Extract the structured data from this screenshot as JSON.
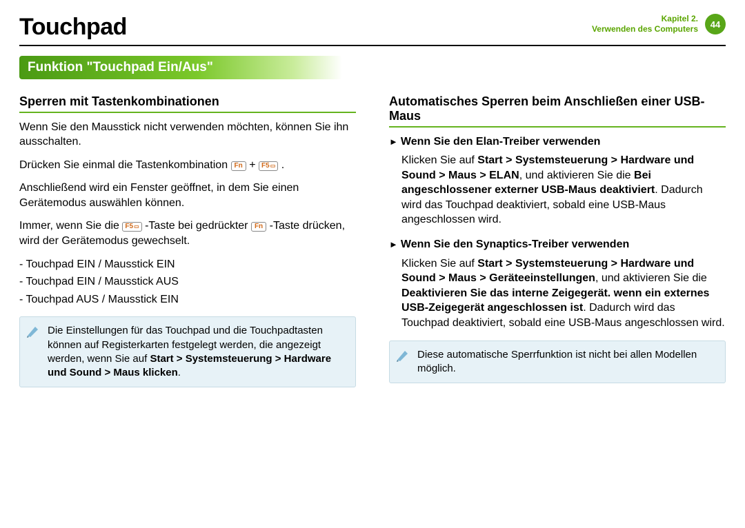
{
  "header": {
    "title": "Touchpad",
    "chapter_line1": "Kapitel 2.",
    "chapter_line2": "Verwenden des Computers",
    "page_number": "44"
  },
  "banner": {
    "label": "Funktion \"Touchpad Ein/Aus\""
  },
  "left": {
    "subhead": "Sperren mit Tastenkombinationen",
    "p1": "Wenn Sie den Mausstick nicht verwenden möchten, können Sie ihn ausschalten.",
    "p2_a": "Drücken Sie einmal die Tastenkombination ",
    "key_fn": "Fn",
    "plus": " + ",
    "key_f5_label": "F5",
    "p2_b": " .",
    "p3": "Anschließend wird ein Fenster geöffnet, in dem Sie einen Gerätemodus auswählen können.",
    "p4_a": "Immer, wenn Sie die ",
    "p4_b": " -Taste bei gedrückter ",
    "p4_c": " -Taste drücken, wird der Gerätemodus gewechselt.",
    "li1": "- Touchpad EIN / Mausstick EIN",
    "li2": "- Touchpad EIN / Mausstick AUS",
    "li3": "- Touchpad AUS / Mausstick EIN",
    "note_a": "Die Einstellungen für das Touchpad und die Touchpadtasten können auf Registerkarten festgelegt werden, die angezeigt werden, wenn Sie auf ",
    "note_b": "Start > Systemsteuerung > Hardware und Sound > Maus klicken",
    "note_c": "."
  },
  "right": {
    "subhead": "Automatisches Sperren beim Anschließen einer USB-Maus",
    "h_elan_tri": "►",
    "h_elan": "Wenn Sie den Elan-Treiber verwenden",
    "elan_a": "Klicken Sie auf ",
    "elan_b": "Start > Systemsteuerung > Hardware und Sound > Maus > ELAN",
    "elan_c": ", und aktivieren Sie die ",
    "elan_d": "Bei angeschlossener externer USB-Maus deaktiviert",
    "elan_e": ". Dadurch wird das Touchpad deaktiviert, sobald eine USB-Maus angeschlossen wird.",
    "h_syn_tri": "►",
    "h_syn": "Wenn Sie den Synaptics-Treiber verwenden",
    "syn_a": "Klicken Sie auf ",
    "syn_b": "Start > Systemsteuerung > Hardware und Sound > Maus > Geräteeinstellungen",
    "syn_c": ", und aktivieren Sie die ",
    "syn_d": "Deaktivieren Sie das interne Zeigegerät. wenn ein externes USB-Zeigegerät angeschlossen ist",
    "syn_e": ". Dadurch wird das Touchpad deaktiviert, sobald eine USB-Maus angeschlossen wird.",
    "note": "Diese automatische Sperrfunktion ist nicht bei allen Modellen möglich."
  }
}
